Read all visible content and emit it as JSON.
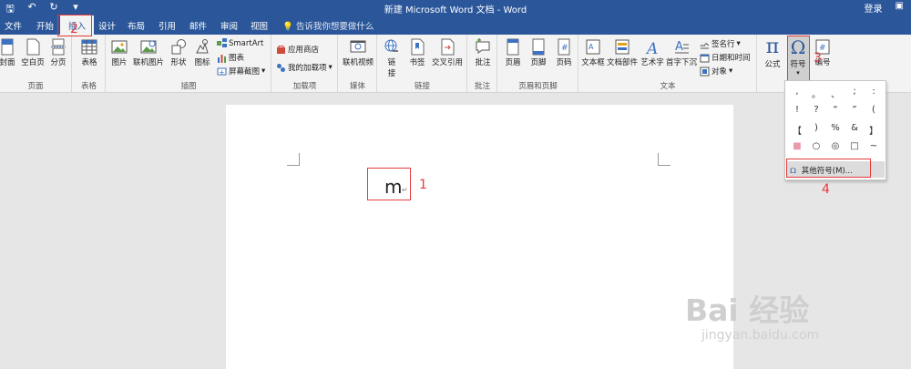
{
  "title": "新建 Microsoft Word 文档 - Word",
  "title_right": {
    "login": "登录"
  },
  "tabs": [
    "文件",
    "开始",
    "插入",
    "设计",
    "布局",
    "引用",
    "邮件",
    "审阅",
    "视图"
  ],
  "tell_me": "告诉我你想要做什么",
  "ribbon": {
    "pages": {
      "label": "页面",
      "cover": "封面",
      "blank": "空白页",
      "break": "分页"
    },
    "tables": {
      "label": "表格",
      "table": "表格"
    },
    "illustrations": {
      "label": "插图",
      "picture": "图片",
      "online_picture": "联机图片",
      "shapes": "形状",
      "icons": "图标",
      "smartart": "SmartArt",
      "chart": "图表",
      "screenshot": "屏幕截图"
    },
    "addins": {
      "label": "加载项",
      "store": "应用商店",
      "my_addins": "我的加载项"
    },
    "media": {
      "label": "媒体",
      "online_video": "联机视频"
    },
    "links": {
      "label": "链接",
      "link_l1": "链",
      "link_l2": "接",
      "bookmark": "书签",
      "cross_ref": "交叉引用"
    },
    "comments": {
      "label": "批注",
      "comment": "批注"
    },
    "header_footer": {
      "label": "页眉和页脚",
      "header": "页眉",
      "footer": "页脚",
      "page_number": "页码"
    },
    "text": {
      "label": "文本",
      "text_box": "文本框",
      "quick_parts": "文档部件",
      "wordart": "艺术字",
      "drop_cap": "首字下沉",
      "signature": "签名行",
      "date_time": "日期和时间",
      "object": "对象"
    },
    "symbols": {
      "equation": "公式",
      "symbol": "符号",
      "number": "编号"
    }
  },
  "document": {
    "text": "m"
  },
  "annotations": {
    "n1": "1",
    "n2": "2",
    "n3": "3",
    "n4": "4"
  },
  "symbol_dropdown": {
    "symbols": [
      ",",
      "。",
      "、",
      ";",
      ":",
      "!",
      "?",
      "“",
      "”",
      "(",
      "【",
      ")",
      "%",
      "&",
      "】",
      "■",
      "○",
      "◎",
      "□",
      "~"
    ],
    "more": "其他符号(M)..."
  },
  "watermark": {
    "main": "Bai 经验",
    "sub": "jingyan.baidu.com"
  },
  "colors": {
    "brand": "#2b579a",
    "annotation": "#e63a3a"
  }
}
